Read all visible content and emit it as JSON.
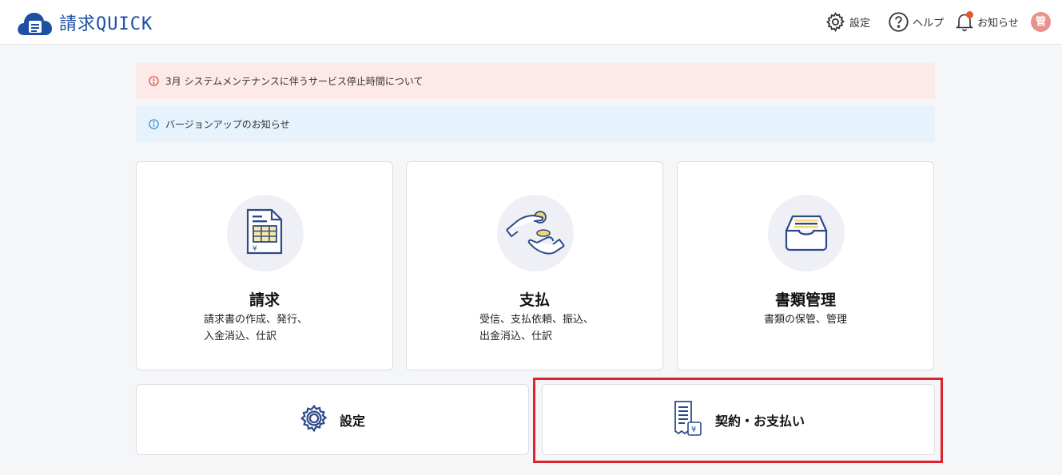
{
  "app": {
    "logo_text": "請求",
    "logo_text_latin": "QUICK"
  },
  "header": {
    "settings_label": "設定",
    "help_label": "ヘルプ",
    "notifications_label": "お知らせ",
    "avatar_initial": "管",
    "notification_dot_color": "#e0592a"
  },
  "banners": {
    "alert_text": "3月 システムメンテナンスに伴うサービス停止時間について",
    "info_text": "バージョンアップのお知らせ"
  },
  "cards": [
    {
      "title": "請求",
      "desc_line1": "請求書の作成、発行、",
      "desc_line2": "入金消込、仕訳",
      "icon": "invoice-document-icon"
    },
    {
      "title": "支払",
      "desc_line1": "受信、支払依頼、振込、",
      "desc_line2": "出金消込、仕訳",
      "icon": "payment-hands-coin-icon"
    },
    {
      "title": "書類管理",
      "desc_line1": "書類の保管、管理",
      "icon": "document-tray-icon"
    }
  ],
  "bottom": {
    "settings_label": "設定",
    "contract_label": "契約・お支払い"
  },
  "colors": {
    "brand": "#1d4fa3",
    "highlight_border": "#e0222f",
    "alert_bg": "#fde9e7",
    "info_bg": "#e6f3fc"
  }
}
